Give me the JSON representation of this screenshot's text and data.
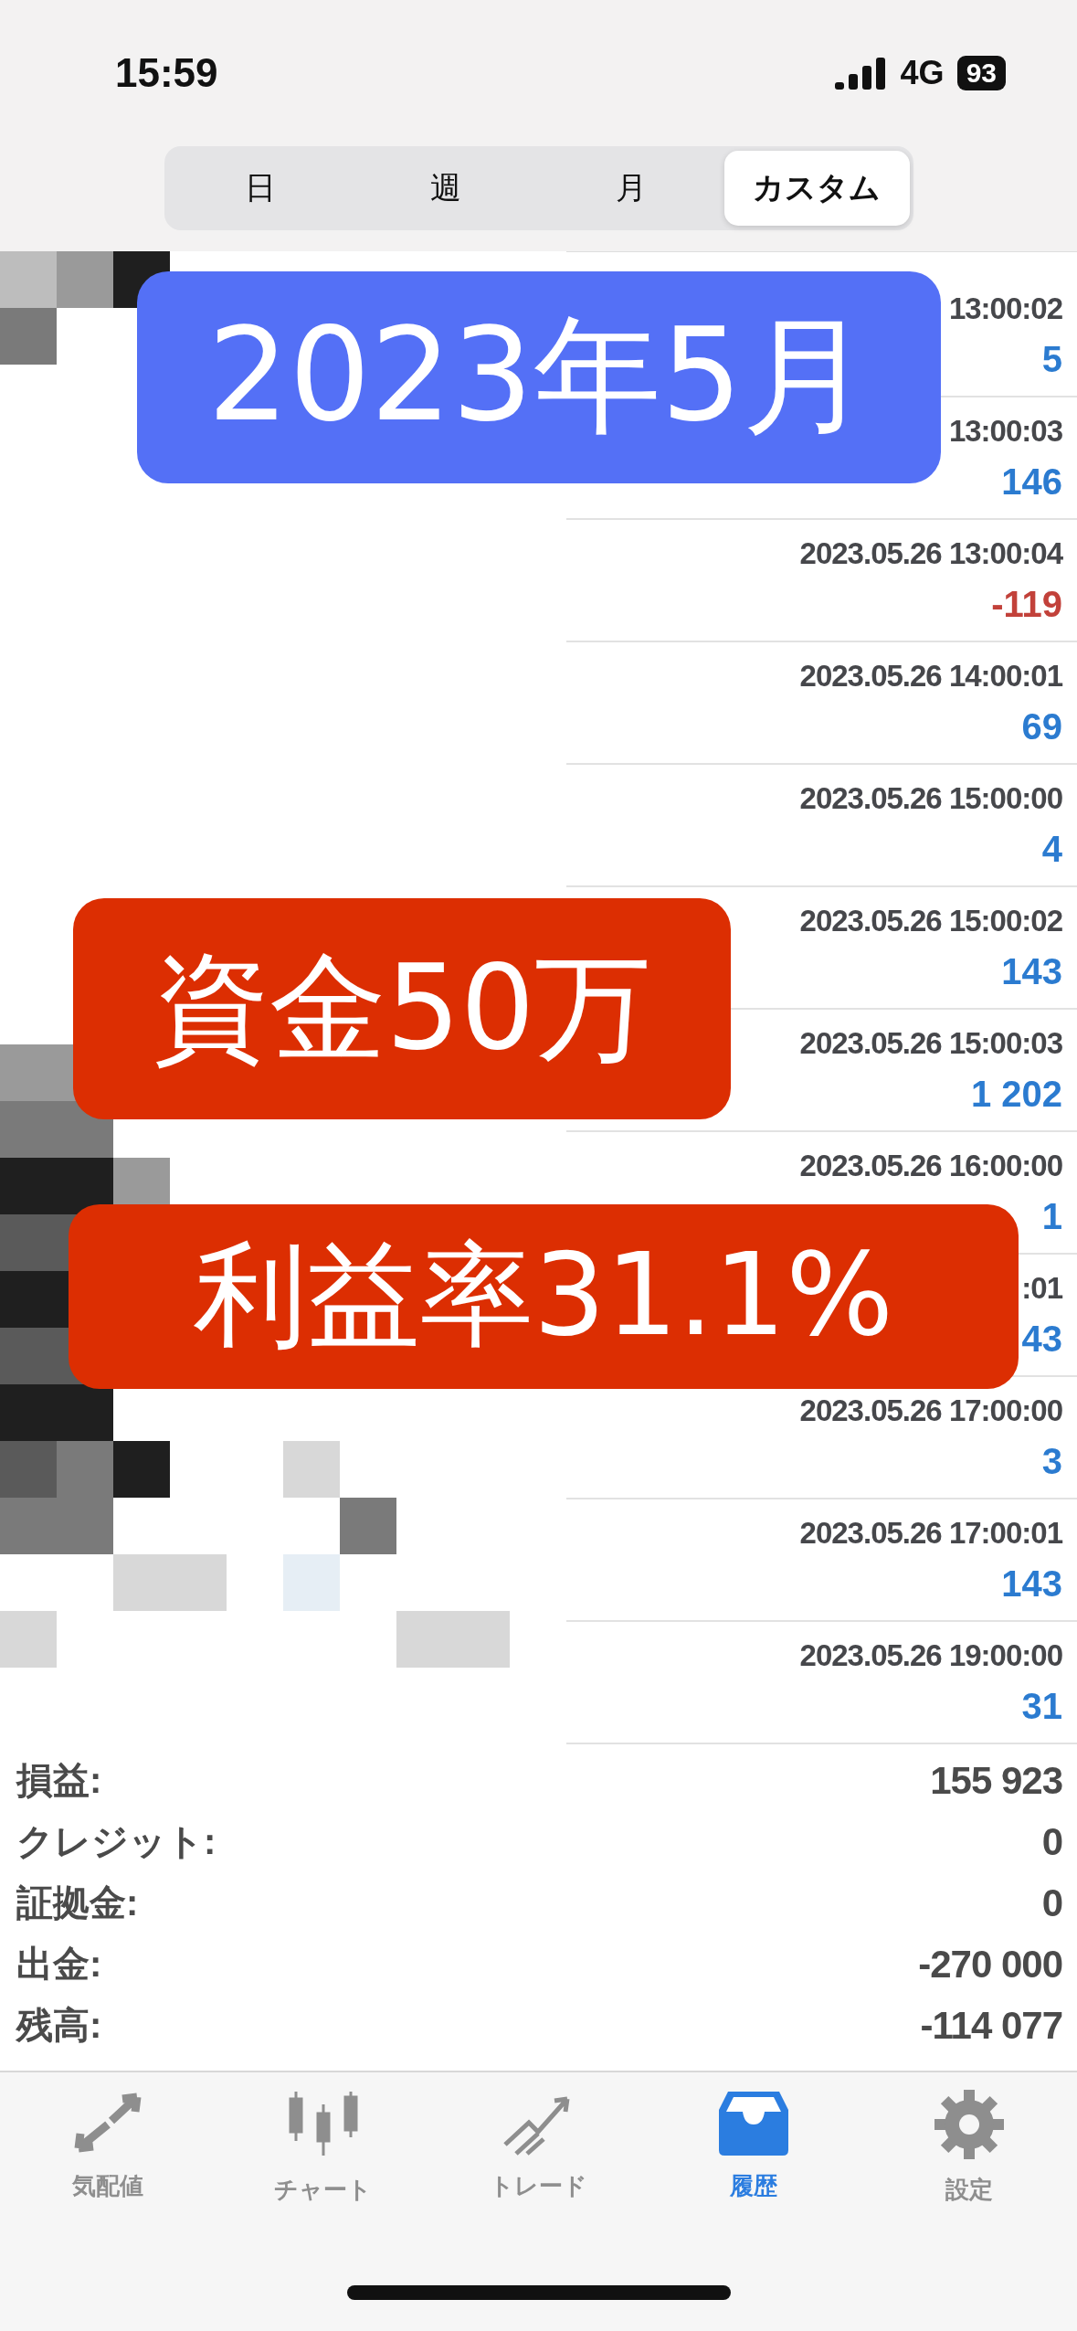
{
  "status_bar": {
    "time": "15:59",
    "network": "4G",
    "battery": "93"
  },
  "period_tabs": [
    {
      "label": "日",
      "selected": false
    },
    {
      "label": "週",
      "selected": false
    },
    {
      "label": "月",
      "selected": false
    },
    {
      "label": "カスタム",
      "selected": true
    }
  ],
  "deals": [
    {
      "time": "13:00:02",
      "profit": "5",
      "negative": false
    },
    {
      "time": "13:00:03",
      "profit": "146",
      "negative": false
    },
    {
      "time": "2023.05.26 13:00:04",
      "profit": "-119",
      "negative": true
    },
    {
      "time": "2023.05.26 14:00:01",
      "profit": "69",
      "negative": false
    },
    {
      "time": "2023.05.26 15:00:00",
      "profit": "4",
      "negative": false
    },
    {
      "time": "2023.05.26 15:00:02",
      "profit": "143",
      "negative": false
    },
    {
      "time": "2023.05.26 15:00:03",
      "profit": "1 202",
      "negative": false
    },
    {
      "time": "2023.05.26 16:00:00",
      "profit": "1",
      "negative": false
    },
    {
      "time": ":01",
      "profit": "43",
      "negative": false
    },
    {
      "time": "2023.05.26 17:00:00",
      "profit": "3",
      "negative": false
    },
    {
      "time": "2023.05.26 17:00:01",
      "profit": "143",
      "negative": false
    },
    {
      "time": "2023.05.26 19:00:00",
      "profit": "31",
      "negative": false
    }
  ],
  "summary": [
    {
      "label": "損益:",
      "value": "155 923"
    },
    {
      "label": "クレジット:",
      "value": "0"
    },
    {
      "label": "証拠金:",
      "value": "0"
    },
    {
      "label": "出金:",
      "value": "-270 000"
    },
    {
      "label": "残高:",
      "value": "-114 077"
    }
  ],
  "overlays": [
    {
      "text": "2023年5月",
      "kind": "blue"
    },
    {
      "text": "資金50万",
      "kind": "red"
    },
    {
      "text": "利益率31.1%",
      "kind": "red"
    }
  ],
  "tab_bar": [
    {
      "label": "気配値",
      "kind": "quotes",
      "selected": false
    },
    {
      "label": "チャート",
      "kind": "chart",
      "selected": false
    },
    {
      "label": "トレード",
      "kind": "trade",
      "selected": false
    },
    {
      "label": "履歴",
      "kind": "history",
      "selected": true
    },
    {
      "label": "設定",
      "kind": "settings",
      "selected": false
    }
  ]
}
